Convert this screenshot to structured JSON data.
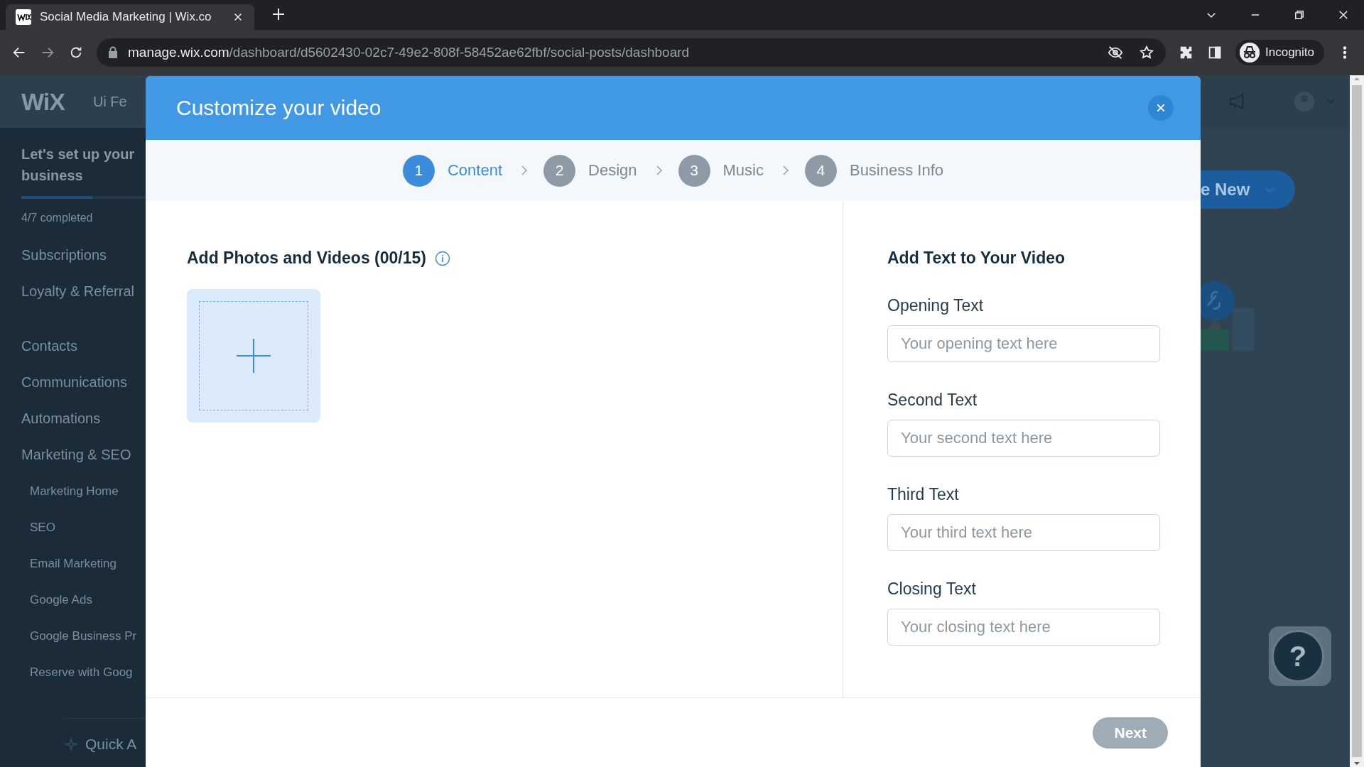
{
  "browser": {
    "tab": {
      "title": "Social Media Marketing | Wix.co"
    },
    "url": {
      "host": "manage.wix.com",
      "path": "/dashboard/d5602430-02c7-49e2-808f-58452ae62fbf/social-posts/dashboard"
    },
    "profile": "Incognito"
  },
  "dashboard": {
    "logo": "WiX",
    "site_name": "Ui Fe",
    "setup": {
      "heading": "Let's set up your business",
      "progress": "4/7 completed",
      "level": 0.57
    },
    "sidebar": [
      {
        "label": "Subscriptions"
      },
      {
        "label": "Loyalty & Referral"
      },
      {
        "label": "Contacts"
      },
      {
        "label": "Communications"
      },
      {
        "label": "Automations"
      },
      {
        "label": "Marketing & SEO",
        "children": [
          {
            "label": "Marketing Home"
          },
          {
            "label": "SEO"
          },
          {
            "label": "Email Marketing"
          },
          {
            "label": "Google Ads"
          },
          {
            "label": "Google Business Pr"
          },
          {
            "label": "Reserve with Goog"
          }
        ]
      }
    ],
    "quick_access": "Quick A",
    "create_button": "e New",
    "help_button": "?"
  },
  "modal": {
    "title": "Customize your video",
    "close": "×",
    "steps": [
      {
        "number": "1",
        "label": "Content",
        "selected": true
      },
      {
        "number": "2",
        "label": "Design",
        "selected": false
      },
      {
        "number": "3",
        "label": "Music",
        "selected": false
      },
      {
        "number": "4",
        "label": "Business Info",
        "selected": false
      }
    ],
    "media": {
      "heading": "Add Photos and Videos (00/15)"
    },
    "text_section": {
      "heading": "Add Text to Your Video",
      "fields": [
        {
          "label": "Opening Text",
          "placeholder": "Your opening text here"
        },
        {
          "label": "Second Text",
          "placeholder": "Your second text here"
        },
        {
          "label": "Third Text",
          "placeholder": "Your third text here"
        },
        {
          "label": "Closing Text",
          "placeholder": "Your closing text here"
        }
      ]
    },
    "next_button": {
      "label": "Next",
      "disabled": true
    }
  }
}
